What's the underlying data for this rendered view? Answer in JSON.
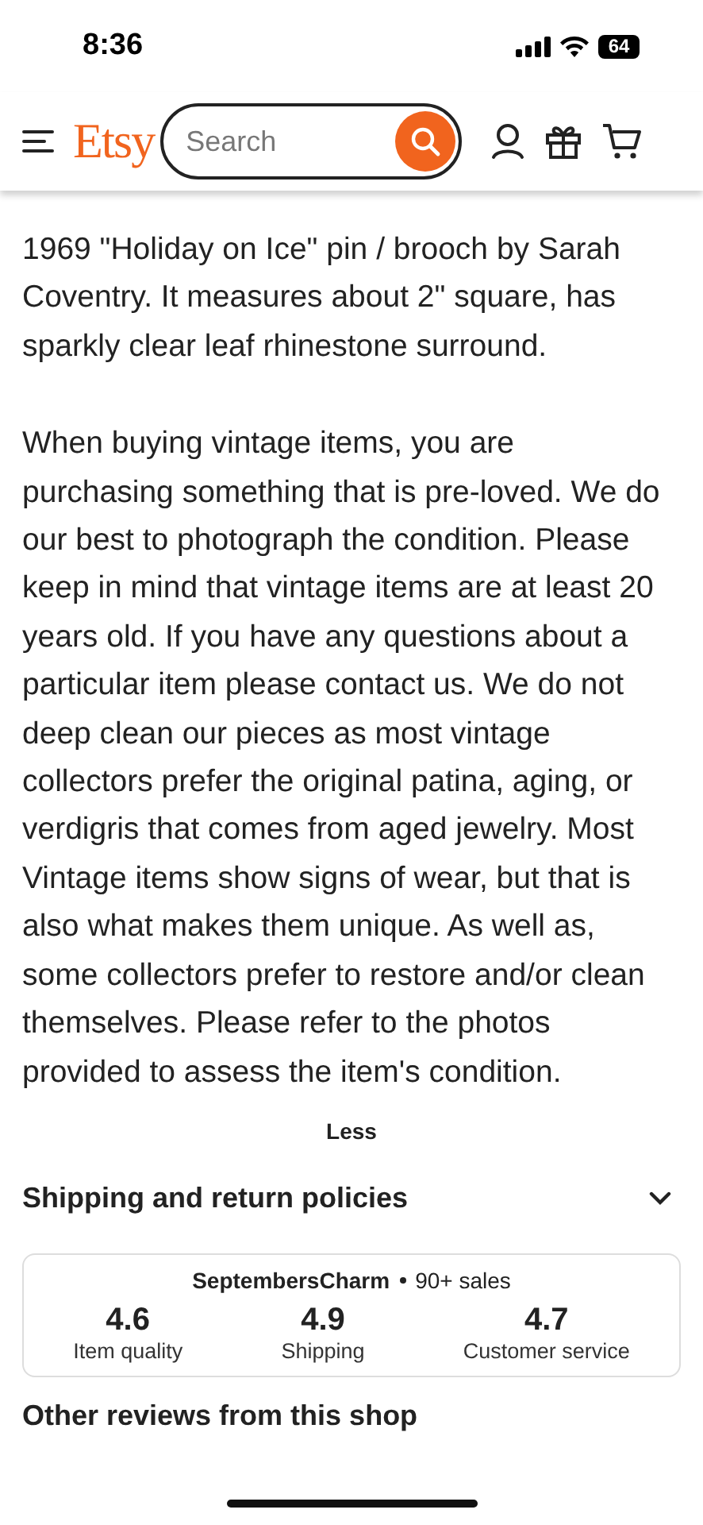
{
  "status_bar": {
    "time": "8:36",
    "battery": "64"
  },
  "header": {
    "logo": "Etsy",
    "search": {
      "placeholder": "Search"
    }
  },
  "description": [
    "1969 \"Holiday on Ice\" pin / brooch by Sarah Coventry. It measures about 2\" square, has sparkly clear leaf rhinestone surround.",
    "When buying vintage items, you are purchasing something that is pre-loved. We do our best to photograph the condition. Please keep in mind that vintage items are at least 20 years old. If you have any questions about a particular item please contact us. We do not deep clean our pieces as most vintage collectors prefer the original patina, aging, or verdigris that comes from aged jewelry. Most Vintage items show signs of wear, but that is also what makes them unique. As well as, some collectors prefer to restore and/or clean themselves. Please refer to the photos provided to assess the item's condition."
  ],
  "less_link": "Less",
  "shipping_section": {
    "title": "Shipping and return policies",
    "expanded": false
  },
  "shop": {
    "name": "SeptembersCharm",
    "sales": "90+ sales",
    "ratings": [
      {
        "value": "4.6",
        "label": "Item quality"
      },
      {
        "value": "4.9",
        "label": "Shipping"
      },
      {
        "value": "4.7",
        "label": "Customer service"
      }
    ]
  },
  "reviews_heading": "Other reviews from this shop"
}
